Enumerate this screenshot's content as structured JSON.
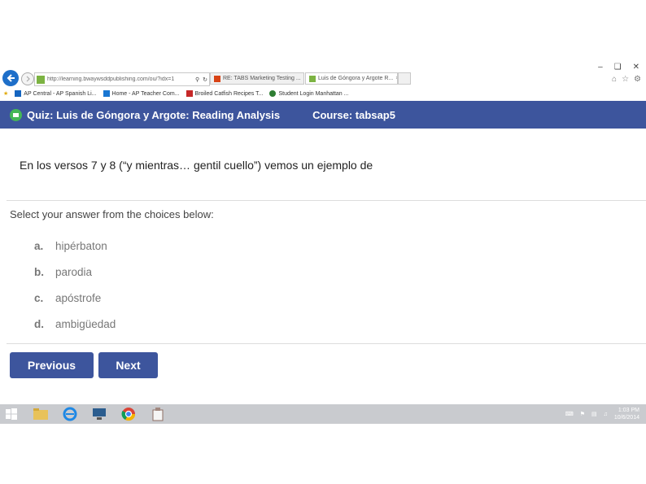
{
  "browser": {
    "address_url": "http://learning.bwaywsddpublishing.com/ou/?idx=1",
    "tabs": [
      {
        "label": "RE: TABS Marketing Testing ..."
      },
      {
        "label": "Luis de Góngora y Argote R..."
      }
    ],
    "bookmarks": [
      {
        "label": "AP Central - AP Spanish Li..."
      },
      {
        "label": "Home - AP Teacher Com..."
      },
      {
        "label": "Broiled Catfish Recipes T..."
      },
      {
        "label": "Student Login Manhattan ..."
      }
    ]
  },
  "quiz": {
    "title": "Quiz: Luis de Góngora y Argote: Reading Analysis",
    "course": "Course: tabsap5",
    "question": "En los versos 7 y 8 (“y mientras… gentil cuello”) vemos un ejemplo de",
    "instruction": "Select your answer from the choices below:",
    "choices": [
      {
        "letter": "a.",
        "text": "hipérbaton"
      },
      {
        "letter": "b.",
        "text": "parodia"
      },
      {
        "letter": "c.",
        "text": "apóstrofe"
      },
      {
        "letter": "d.",
        "text": "ambigüedad"
      }
    ],
    "previous_label": "Previous",
    "next_label": "Next"
  },
  "taskbar": {
    "time": "1:03 PM",
    "date": "10/6/2014"
  },
  "colors": {
    "header": "#3d559d",
    "button": "#3d559d",
    "back_button": "#1e6fc9",
    "taskbar": "#c9cbcf"
  },
  "icons": [
    "back-arrow-icon",
    "forward-arrow-icon",
    "search-icon",
    "refresh-icon",
    "home-icon",
    "star-icon",
    "gear-icon",
    "quiz-icon",
    "windows-icon",
    "folder-icon",
    "internet-explorer-icon",
    "computer-icon",
    "chrome-icon",
    "app-icon"
  ]
}
